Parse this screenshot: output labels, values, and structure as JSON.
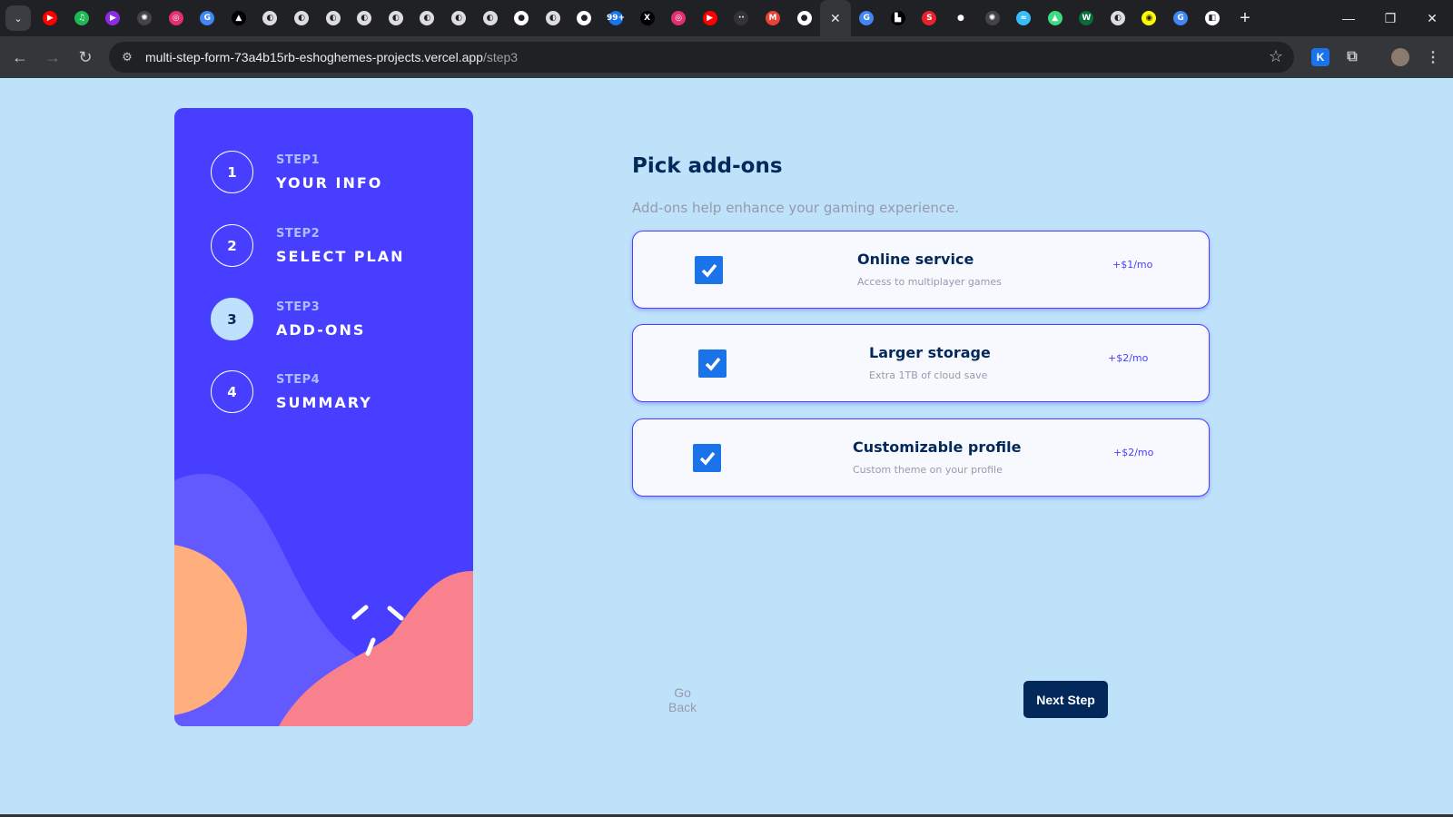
{
  "browser": {
    "url_host": "multi-step-form-73a4b15rb-eshoghemes-projects.vercel.app",
    "url_path": "/step3",
    "tabs": [
      {
        "icon": "youtube-icon",
        "glyph": "▶",
        "color": "#ff0000"
      },
      {
        "icon": "spotify-icon",
        "glyph": "♫",
        "color": "#1db954"
      },
      {
        "icon": "play-icon",
        "glyph": "▶",
        "color": "#8b2be2"
      },
      {
        "icon": "openai-icon",
        "glyph": "✺",
        "color": "#444444"
      },
      {
        "icon": "instagram-icon",
        "glyph": "◎",
        "color": "#e1306c"
      },
      {
        "icon": "google-icon",
        "glyph": "G",
        "color": "#4285f4"
      },
      {
        "icon": "triangle-icon",
        "glyph": "▲",
        "color": "#000000"
      },
      {
        "icon": "globe-icon",
        "glyph": "◐",
        "color": "#dddddd"
      },
      {
        "icon": "globe-icon",
        "glyph": "◐",
        "color": "#dddddd"
      },
      {
        "icon": "globe-icon",
        "glyph": "◐",
        "color": "#dddddd"
      },
      {
        "icon": "globe-icon",
        "glyph": "◐",
        "color": "#dddddd"
      },
      {
        "icon": "globe-icon",
        "glyph": "◐",
        "color": "#dddddd"
      },
      {
        "icon": "globe-icon",
        "glyph": "◐",
        "color": "#dddddd"
      },
      {
        "icon": "globe-icon",
        "glyph": "◐",
        "color": "#dddddd"
      },
      {
        "icon": "globe-icon",
        "glyph": "◐",
        "color": "#dddddd"
      },
      {
        "icon": "github-icon",
        "glyph": "●",
        "color": "#ffffff"
      },
      {
        "icon": "globe-icon",
        "glyph": "◐",
        "color": "#dddddd"
      },
      {
        "icon": "github-icon",
        "glyph": "●",
        "color": "#ffffff"
      },
      {
        "icon": "notification-icon",
        "glyph": "99+",
        "color": "#1a73e8"
      },
      {
        "icon": "x-icon",
        "glyph": "X",
        "color": "#000000"
      },
      {
        "icon": "instagram-icon",
        "glyph": "◎",
        "color": "#e1306c"
      },
      {
        "icon": "youtube-icon",
        "glyph": "▶",
        "color": "#ff0000"
      },
      {
        "icon": "site-icon",
        "glyph": "··",
        "color": "#333333"
      },
      {
        "icon": "gmail-icon",
        "glyph": "M",
        "color": "#ea4335"
      },
      {
        "icon": "github-icon",
        "glyph": "●",
        "color": "#ffffff"
      }
    ],
    "active_tab_close": "✕",
    "tabs_after": [
      {
        "icon": "google-icon",
        "glyph": "G",
        "color": "#4285f4"
      },
      {
        "icon": "site-icon",
        "glyph": "▙",
        "color": "#000000"
      },
      {
        "icon": "s-icon",
        "glyph": "S",
        "color": "#e8222d"
      },
      {
        "icon": "dark-icon",
        "glyph": "●",
        "color": "#222222"
      },
      {
        "icon": "openai-icon",
        "glyph": "✺",
        "color": "#444444"
      },
      {
        "icon": "tailwind-icon",
        "glyph": "≈",
        "color": "#38bdf8"
      },
      {
        "icon": "android-icon",
        "glyph": "▲",
        "color": "#3ddc84"
      },
      {
        "icon": "w-icon",
        "glyph": "W",
        "color": "#0b6b3a"
      },
      {
        "icon": "globe-icon",
        "glyph": "◐",
        "color": "#dddddd"
      },
      {
        "icon": "snapchat-icon",
        "glyph": "◉",
        "color": "#fffc00"
      },
      {
        "icon": "google-icon",
        "glyph": "G",
        "color": "#4285f4"
      },
      {
        "icon": "blank-icon",
        "glyph": "◧",
        "color": "#ffffff"
      }
    ],
    "extension_label": "K"
  },
  "sidebar": {
    "steps": [
      {
        "number": "1",
        "label": "STEP1",
        "title": "YOUR INFO",
        "active": false
      },
      {
        "number": "2",
        "label": "STEP2",
        "title": "SELECT PLAN",
        "active": false
      },
      {
        "number": "3",
        "label": "STEP3",
        "title": "ADD-ONS",
        "active": true
      },
      {
        "number": "4",
        "label": "STEP4",
        "title": "SUMMARY",
        "active": false
      }
    ]
  },
  "main": {
    "title": "Pick add-ons",
    "subtitle": "Add-ons help enhance your gaming experience.",
    "addons": [
      {
        "name": "Online service",
        "description": "Access to multiplayer games",
        "price": "+$1/mo",
        "checked": true
      },
      {
        "name": "Larger storage",
        "description": "Extra 1TB of cloud save",
        "price": "+$2/mo",
        "checked": true
      },
      {
        "name": "Customizable profile",
        "description": "Custom theme on your profile",
        "price": "+$2/mo",
        "checked": true
      }
    ],
    "back_label": "Go Back",
    "next_label": "Next Step"
  },
  "colors": {
    "page_bg": "#bfe2fb",
    "sidebar_bg": "#483eff",
    "accent": "#483eff",
    "marine_blue": "#02295a",
    "checkbox": "#1a73e8"
  }
}
